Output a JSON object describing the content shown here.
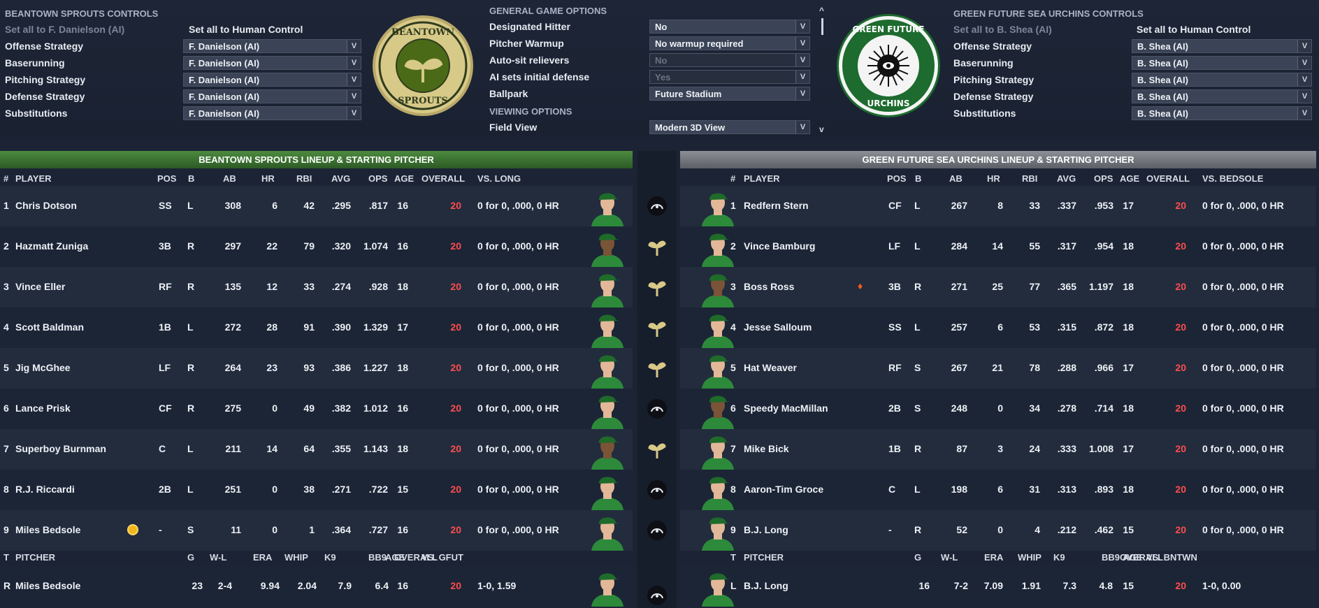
{
  "left_controls": {
    "title": "BEANTOWN SPROUTS CONTROLS",
    "set_all_ai": "Set all to F. Danielson (AI)",
    "set_all_human": "Set all to Human Control",
    "rows": [
      {
        "label": "Offense Strategy",
        "value": "F. Danielson (AI)"
      },
      {
        "label": "Baserunning",
        "value": "F. Danielson (AI)"
      },
      {
        "label": "Pitching Strategy",
        "value": "F. Danielson (AI)"
      },
      {
        "label": "Defense Strategy",
        "value": "F. Danielson (AI)"
      },
      {
        "label": "Substitutions",
        "value": "F. Danielson (AI)"
      }
    ]
  },
  "right_controls": {
    "title": "GREEN FUTURE SEA URCHINS CONTROLS",
    "set_all_ai": "Set all to B. Shea (AI)",
    "set_all_human": "Set all to Human Control",
    "rows": [
      {
        "label": "Offense Strategy",
        "value": "B. Shea (AI)"
      },
      {
        "label": "Baserunning",
        "value": "B. Shea (AI)"
      },
      {
        "label": "Pitching Strategy",
        "value": "B. Shea (AI)"
      },
      {
        "label": "Defense Strategy",
        "value": "B. Shea (AI)"
      },
      {
        "label": "Substitutions",
        "value": "B. Shea (AI)"
      }
    ]
  },
  "logos": {
    "left_top": "BEANTOWN",
    "left_bottom": "SPROUTS",
    "right_top": "GREEN FUTURE",
    "right_bottom": "URCHINS"
  },
  "options": {
    "general_title": "GENERAL GAME OPTIONS",
    "viewing_title": "VIEWING OPTIONS",
    "rows": [
      {
        "label": "Designated Hitter",
        "value": "No"
      },
      {
        "label": "Pitcher Warmup",
        "value": "No warmup required"
      },
      {
        "label": "Auto-sit relievers",
        "value": "No"
      },
      {
        "label": "AI sets initial defense",
        "value": "Yes"
      },
      {
        "label": "Ballpark",
        "value": "Future Stadium"
      }
    ],
    "field_view_label": "Field View",
    "field_view_value": "Modern 3D View"
  },
  "left_lineup": {
    "title": "BEANTOWN SPROUTS LINEUP & STARTING PITCHER",
    "headers": [
      "#",
      "PLAYER",
      "POS",
      "B",
      "AB",
      "HR",
      "RBI",
      "AVG",
      "OPS",
      "AGE",
      "OVERALL",
      "VS. LONG"
    ],
    "players": [
      {
        "n": "1",
        "name": "Chris Dotson",
        "pos": "SS",
        "b": "L",
        "ab": "308",
        "hr": "6",
        "rbi": "42",
        "avg": ".295",
        "ops": ".817",
        "age": "16",
        "ovr": "20",
        "vs": "0 for 0, .000, 0 HR"
      },
      {
        "n": "2",
        "name": "Hazmatt Zuniga",
        "pos": "3B",
        "b": "R",
        "ab": "297",
        "hr": "22",
        "rbi": "79",
        "avg": ".320",
        "ops": "1.074",
        "age": "16",
        "ovr": "20",
        "vs": "0 for 0, .000, 0 HR"
      },
      {
        "n": "3",
        "name": "Vince Eller",
        "pos": "RF",
        "b": "R",
        "ab": "135",
        "hr": "12",
        "rbi": "33",
        "avg": ".274",
        "ops": ".928",
        "age": "18",
        "ovr": "20",
        "vs": "0 for 0, .000, 0 HR"
      },
      {
        "n": "4",
        "name": "Scott Baldman",
        "pos": "1B",
        "b": "L",
        "ab": "272",
        "hr": "28",
        "rbi": "91",
        "avg": ".390",
        "ops": "1.329",
        "age": "17",
        "ovr": "20",
        "vs": "0 for 0, .000, 0 HR"
      },
      {
        "n": "5",
        "name": "Jig McGhee",
        "pos": "LF",
        "b": "R",
        "ab": "264",
        "hr": "23",
        "rbi": "93",
        "avg": ".386",
        "ops": "1.227",
        "age": "18",
        "ovr": "20",
        "vs": "0 for 0, .000, 0 HR"
      },
      {
        "n": "6",
        "name": "Lance Prisk",
        "pos": "CF",
        "b": "R",
        "ab": "275",
        "hr": "0",
        "rbi": "49",
        "avg": ".382",
        "ops": "1.012",
        "age": "16",
        "ovr": "20",
        "vs": "0 for 0, .000, 0 HR"
      },
      {
        "n": "7",
        "name": "Superboy Burnman",
        "pos": "C",
        "b": "L",
        "ab": "211",
        "hr": "14",
        "rbi": "64",
        "avg": ".355",
        "ops": "1.143",
        "age": "18",
        "ovr": "20",
        "vs": "0 for 0, .000, 0 HR"
      },
      {
        "n": "8",
        "name": "R.J. Riccardi",
        "pos": "2B",
        "b": "L",
        "ab": "251",
        "hr": "0",
        "rbi": "38",
        "avg": ".271",
        "ops": ".722",
        "age": "15",
        "ovr": "20",
        "vs": "0 for 0, .000, 0 HR"
      },
      {
        "n": "9",
        "name": "Miles Bedsole",
        "pos": "-",
        "b": "S",
        "ab": "11",
        "hr": "0",
        "rbi": "1",
        "avg": ".364",
        "ops": ".727",
        "age": "16",
        "ovr": "20",
        "vs": "0 for 0, .000, 0 HR"
      }
    ],
    "pitcher_headers": [
      "T",
      "PITCHER",
      "G",
      "W-L",
      "ERA",
      "WHIP",
      "K9",
      "BB9",
      "AGE",
      "OVERALL",
      "VS. GFUT"
    ],
    "pitcher": {
      "t": "R",
      "name": "Miles Bedsole",
      "g": "23",
      "wl": "2-4",
      "era": "9.94",
      "whip": "2.04",
      "k9": "7.9",
      "bb9": "6.4",
      "age": "16",
      "ovr": "20",
      "vs": "1-0, 1.59"
    }
  },
  "right_lineup": {
    "title": "GREEN FUTURE SEA URCHINS LINEUP & STARTING PITCHER",
    "headers": [
      "#",
      "PLAYER",
      "POS",
      "B",
      "AB",
      "HR",
      "RBI",
      "AVG",
      "OPS",
      "AGE",
      "OVERALL",
      "VS. BEDSOLE"
    ],
    "players": [
      {
        "n": "1",
        "name": "Redfern Stern",
        "pos": "CF",
        "b": "L",
        "ab": "267",
        "hr": "8",
        "rbi": "33",
        "avg": ".337",
        "ops": ".953",
        "age": "17",
        "ovr": "20",
        "vs": "0 for 0, .000, 0 HR"
      },
      {
        "n": "2",
        "name": "Vince Bamburg",
        "pos": "LF",
        "b": "L",
        "ab": "284",
        "hr": "14",
        "rbi": "55",
        "avg": ".317",
        "ops": ".954",
        "age": "18",
        "ovr": "20",
        "vs": "0 for 0, .000, 0 HR"
      },
      {
        "n": "3",
        "name": "Boss Ross",
        "pos": "3B",
        "b": "R",
        "ab": "271",
        "hr": "25",
        "rbi": "77",
        "avg": ".365",
        "ops": "1.197",
        "age": "18",
        "ovr": "20",
        "vs": "0 for 0, .000, 0 HR"
      },
      {
        "n": "4",
        "name": "Jesse Salloum",
        "pos": "SS",
        "b": "L",
        "ab": "257",
        "hr": "6",
        "rbi": "53",
        "avg": ".315",
        "ops": ".872",
        "age": "18",
        "ovr": "20",
        "vs": "0 for 0, .000, 0 HR"
      },
      {
        "n": "5",
        "name": "Hat Weaver",
        "pos": "RF",
        "b": "S",
        "ab": "267",
        "hr": "21",
        "rbi": "78",
        "avg": ".288",
        "ops": ".966",
        "age": "17",
        "ovr": "20",
        "vs": "0 for 0, .000, 0 HR"
      },
      {
        "n": "6",
        "name": "Speedy MacMillan",
        "pos": "2B",
        "b": "S",
        "ab": "248",
        "hr": "0",
        "rbi": "34",
        "avg": ".278",
        "ops": ".714",
        "age": "18",
        "ovr": "20",
        "vs": "0 for 0, .000, 0 HR"
      },
      {
        "n": "7",
        "name": "Mike Bick",
        "pos": "1B",
        "b": "R",
        "ab": "87",
        "hr": "3",
        "rbi": "24",
        "avg": ".333",
        "ops": "1.008",
        "age": "17",
        "ovr": "20",
        "vs": "0 for 0, .000, 0 HR"
      },
      {
        "n": "8",
        "name": "Aaron-Tim Groce",
        "pos": "C",
        "b": "L",
        "ab": "198",
        "hr": "6",
        "rbi": "31",
        "avg": ".313",
        "ops": ".893",
        "age": "18",
        "ovr": "20",
        "vs": "0 for 0, .000, 0 HR"
      },
      {
        "n": "9",
        "name": "B.J. Long",
        "pos": "-",
        "b": "R",
        "ab": "52",
        "hr": "0",
        "rbi": "4",
        "avg": ".212",
        "ops": ".462",
        "age": "15",
        "ovr": "20",
        "vs": "0 for 0, .000, 0 HR"
      }
    ],
    "pitcher_headers": [
      "T",
      "PITCHER",
      "G",
      "W-L",
      "ERA",
      "WHIP",
      "K9",
      "BB9",
      "AGE",
      "OVERALL",
      "VS. BNTWN"
    ],
    "pitcher": {
      "t": "L",
      "name": "B.J. Long",
      "g": "16",
      "wl": "7-2",
      "era": "7.09",
      "whip": "1.91",
      "k9": "7.3",
      "bb9": "4.8",
      "age": "15",
      "ovr": "20",
      "vs": "1-0, 0.00"
    }
  },
  "icons": {
    "left_mid": [
      "urchin-icon",
      "sprout-icon",
      "sprout-icon",
      "sprout-icon",
      "sprout-icon",
      "urchin-icon",
      "sprout-icon",
      "urchin-icon",
      "urchin-icon"
    ],
    "pitcher_mid": "urchin-icon",
    "bedsole_badge": "star-badge-icon",
    "ross_badge": "fire-icon"
  },
  "colors": {
    "accent_red": "#ff4d4d",
    "sprouts_green": "#3f7f35",
    "urchins_gray": "#7f8389",
    "logo_gold": "#d7c987",
    "urchin_green": "#1d6b2e"
  }
}
